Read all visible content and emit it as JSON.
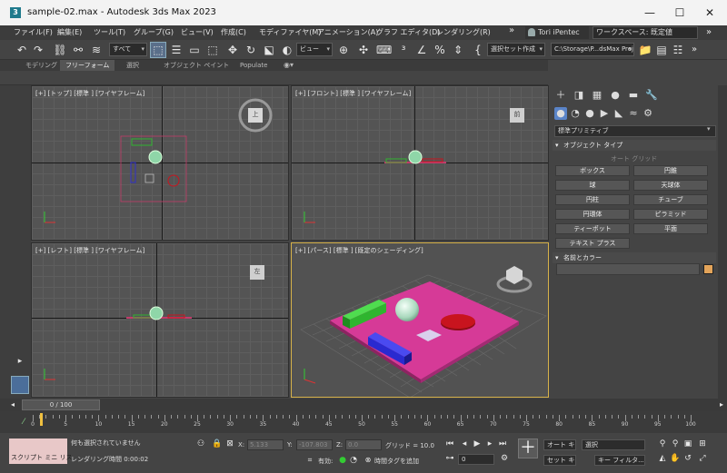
{
  "window": {
    "title": "sample-02.max - Autodesk 3ds Max 2023",
    "controls": [
      "—",
      "☐",
      "✕"
    ]
  },
  "menu": {
    "items": [
      "ファイル(F)",
      "編集(E)",
      "ツール(T)",
      "グループ(G)",
      "ビュー(V)",
      "作成(C)",
      "モディファイヤ(M)",
      "アニメーション(A)",
      "グラフ エディタ(D)",
      "レンダリング(R)"
    ],
    "overflow": "»",
    "user": "Tori iPentec",
    "workspace": "ワークスペース: 既定値"
  },
  "toolbar": {
    "selection_filter": "すべて",
    "view_dropdown": "ビュー",
    "named_selection": "選択セット作成",
    "project_path": "C:\\Storage\\P...dsMax Project"
  },
  "ribbon": {
    "tabs": [
      "モデリング",
      "フリーフォーム",
      "選択",
      "オブジェクト ペイント",
      "Populate"
    ]
  },
  "viewports": {
    "top": "[+] [トップ] [標準 ] [ワイヤフレーム]",
    "front": "[+] [フロント] [標準 ] [ワイヤフレーム]",
    "left": "[+] [レフト] [標準 ] [ワイヤフレーム]",
    "persp": "[+] [パース] [標準 ] [既定のシェーディング]",
    "cube_top": "上",
    "cube_front": "前",
    "cube_left": "左"
  },
  "command_panel": {
    "category": "標準プリミティブ",
    "object_type_title": "オブジェクト タイプ",
    "autogrid": "オート グリッド",
    "buttons": [
      "ボックス",
      "円錐",
      "球",
      "天球体",
      "円柱",
      "チューブ",
      "円環体",
      "ピラミッド",
      "ティーポット",
      "平面",
      "テキスト プラス"
    ],
    "name_color_title": "名前とカラー"
  },
  "timeline": {
    "frame": "0 / 100",
    "ticks": [
      "0",
      "5",
      "10",
      "15",
      "20",
      "25",
      "30",
      "35",
      "40",
      "45",
      "50",
      "55",
      "60",
      "65",
      "70",
      "75",
      "80",
      "85",
      "90",
      "95",
      "100"
    ]
  },
  "status": {
    "script_label": "スクリプト ミニ リス",
    "selection_msg": "何も選択されていません",
    "render_time": "レンダリング時間 0:00:02",
    "x_label": "X:",
    "x_value": "5.133",
    "y_label": "Y:",
    "y_value": "-107.803",
    "z_label": "Z:",
    "z_value": "0.0",
    "grid": "グリッド = 10.0",
    "enabled_label": "有効:",
    "add_time_tag": "時間タグを追加",
    "autokey": "オート キー",
    "setkey": "セット キー",
    "key_mode": "選択",
    "key_filter": "キー フィルタ...",
    "frame_field": "0"
  },
  "colors": {
    "accent": "#4b6e9a",
    "plane": "#d63a97",
    "box_green": "#2fb52f",
    "box_blue": "#2a2ad0",
    "sphere": "#c9ecd9",
    "cylinder": "#c8141e",
    "active_border": "#d7b24a"
  }
}
